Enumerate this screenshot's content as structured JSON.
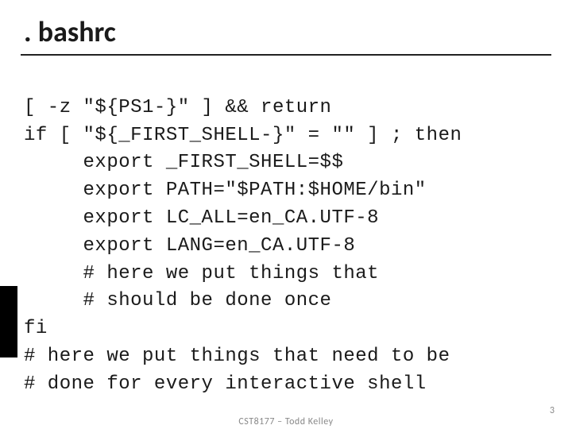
{
  "slide": {
    "title": ". bashrc",
    "code_lines": [
      "[ -z \"${PS1-}\" ] && return",
      "if [ \"${_FIRST_SHELL-}\" = \"\" ] ; then",
      "     export _FIRST_SHELL=$$",
      "     export PATH=\"$PATH:$HOME/bin\"",
      "     export LC_ALL=en_CA.UTF-8",
      "     export LANG=en_CA.UTF-8",
      "     # here we put things that",
      "     # should be done once",
      "fi",
      "# here we put things that need to be",
      "# done for every interactive shell"
    ],
    "footer_center": "CST8177 – Todd Kelley",
    "page_number": "3"
  }
}
